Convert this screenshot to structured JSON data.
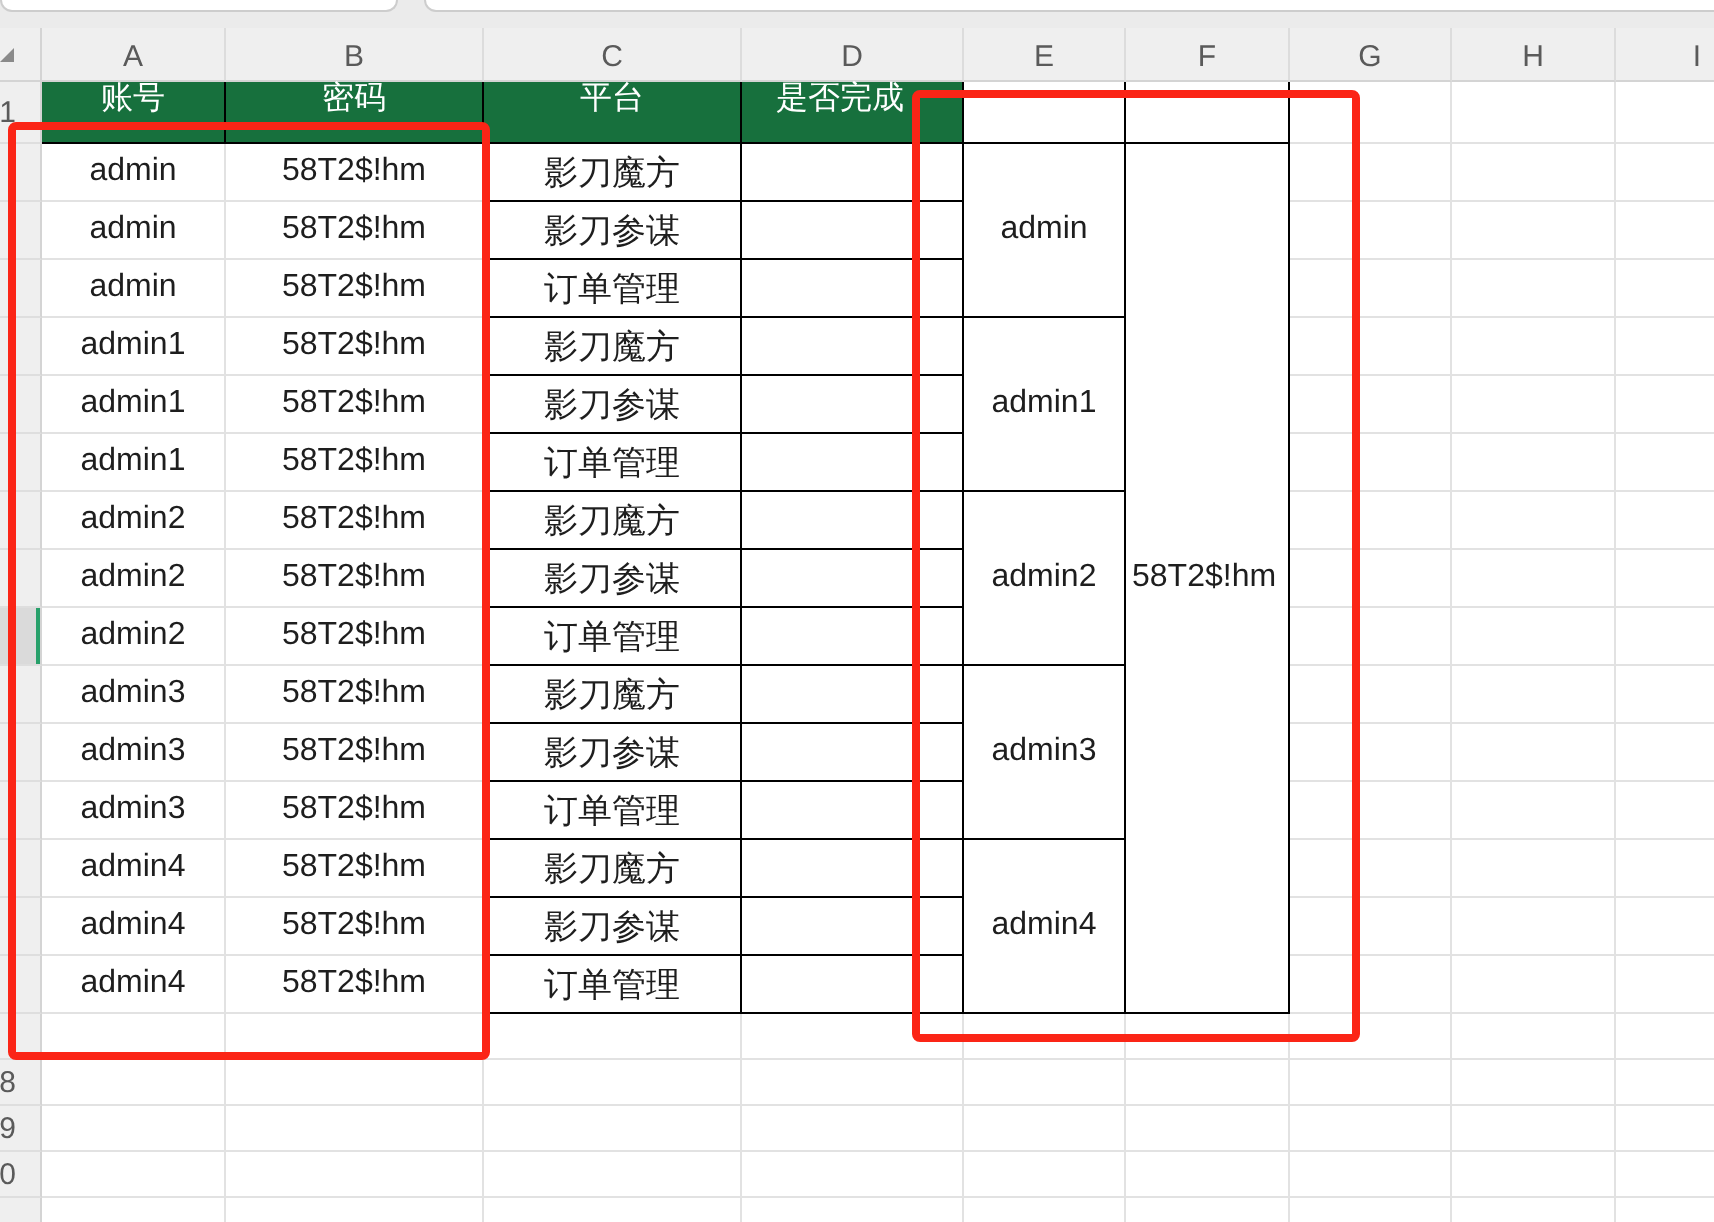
{
  "formula_bar": {
    "fields": [
      {
        "kind": "name_box"
      },
      {
        "kind": "formula_input"
      }
    ]
  },
  "columns": [
    "A",
    "B",
    "C",
    "D",
    "E",
    "F",
    "G",
    "H",
    "I"
  ],
  "rows": [
    {
      "label": "1",
      "selected": false
    },
    {
      "selected": false
    },
    {
      "selected": false
    },
    {
      "selected": false
    },
    {
      "selected": false
    },
    {
      "selected": false
    },
    {
      "selected": false
    },
    {
      "selected": false
    },
    {
      "selected": false
    },
    {
      "selected": true
    },
    {
      "selected": false
    },
    {
      "selected": false
    },
    {
      "selected": false
    },
    {
      "selected": false
    },
    {
      "selected": false
    },
    {
      "selected": false
    },
    {
      "selected": false
    },
    {
      "label": "8",
      "selected": false
    },
    {
      "label": "9",
      "selected": false
    },
    {
      "label": "0",
      "selected": false
    }
  ],
  "table": {
    "headers": [
      "账号",
      "密码",
      "平台",
      "是否完成"
    ],
    "groups": [
      {
        "merged_account": "admin",
        "rows": [
          {
            "account": "admin",
            "password": "58T2$!hm",
            "platform": "影刀魔方"
          },
          {
            "account": "admin",
            "password": "58T2$!hm",
            "platform": "影刀参谋"
          },
          {
            "account": "admin",
            "password": "58T2$!hm",
            "platform": "订单管理"
          }
        ]
      },
      {
        "merged_account": "admin1",
        "rows": [
          {
            "account": "admin1",
            "password": "58T2$!hm",
            "platform": "影刀魔方"
          },
          {
            "account": "admin1",
            "password": "58T2$!hm",
            "platform": "影刀参谋"
          },
          {
            "account": "admin1",
            "password": "58T2$!hm",
            "platform": "订单管理"
          }
        ]
      },
      {
        "merged_account": "admin2",
        "rows": [
          {
            "account": "admin2",
            "password": "58T2$!hm",
            "platform": "影刀魔方"
          },
          {
            "account": "admin2",
            "password": "58T2$!hm",
            "platform": "影刀参谋"
          },
          {
            "account": "admin2",
            "password": "58T2$!hm",
            "platform": "订单管理"
          }
        ]
      },
      {
        "merged_account": "admin3",
        "rows": [
          {
            "account": "admin3",
            "password": "58T2$!hm",
            "platform": "影刀魔方"
          },
          {
            "account": "admin3",
            "password": "58T2$!hm",
            "platform": "影刀参谋"
          },
          {
            "account": "admin3",
            "password": "58T2$!hm",
            "platform": "订单管理"
          }
        ]
      },
      {
        "merged_account": "admin4",
        "rows": [
          {
            "account": "admin4",
            "password": "58T2$!hm",
            "platform": "影刀魔方"
          },
          {
            "account": "admin4",
            "password": "58T2$!hm",
            "platform": "影刀参谋"
          },
          {
            "account": "admin4",
            "password": "58T2$!hm",
            "platform": "订单管理"
          }
        ]
      }
    ],
    "merged_password": "58T2$!hm"
  },
  "annotation_frames": [
    {
      "kind": "rectangle"
    },
    {
      "kind": "rectangle"
    }
  ]
}
